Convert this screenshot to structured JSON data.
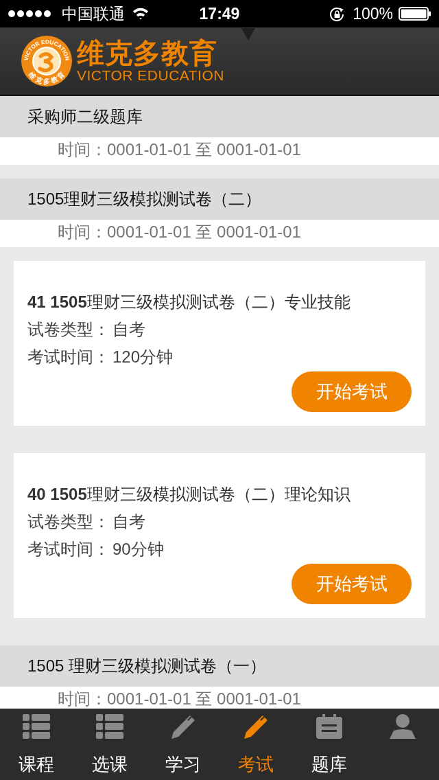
{
  "status_bar": {
    "carrier": "中国联通",
    "time": "17:49",
    "battery": "100%"
  },
  "header": {
    "brand_name": "维克多教育",
    "brand_subtitle": "VICTOR EDUCATION",
    "emblem_ring_text": "VICTOR EDUCATION",
    "emblem_bottom_text": "维克多教育"
  },
  "sections": [
    {
      "title": "采购师二级题库",
      "time": "时间：0001-01-01 至 0001-01-01"
    },
    {
      "title": "1505理财三级模拟测试卷（二）",
      "time": "时间：0001-01-01 至 0001-01-01",
      "exams": [
        {
          "title": "**41 1505**理财三级模拟测试卷（二）专业技能",
          "fields": [
            {
              "label": "试卷类型：",
              "value": "自考"
            },
            {
              "label": "考试时间：",
              "value": "120分钟"
            }
          ],
          "button": "开始考试"
        },
        {
          "title": "**40 1505**理财三级模拟测试卷（二）理论知识",
          "fields": [
            {
              "label": "试卷类型：",
              "value": "自考"
            },
            {
              "label": "考试时间：",
              "value": "90分钟"
            }
          ],
          "button": "开始考试"
        }
      ]
    },
    {
      "title": "1505 理财三级模拟测试卷（一）",
      "time": "时间：0001-01-01 至 0001-01-01"
    }
  ],
  "tab_bar": [
    {
      "kind": "list",
      "label": "课程",
      "selected": false
    },
    {
      "kind": "list",
      "label": "选课",
      "selected": false
    },
    {
      "kind": "pencil",
      "label": "学习",
      "selected": false
    },
    {
      "kind": "pencil",
      "label": "考试",
      "selected": true
    },
    {
      "kind": "clipboard",
      "label": "题库",
      "selected": false
    },
    {
      "kind": "person",
      "selected": false
    }
  ]
}
